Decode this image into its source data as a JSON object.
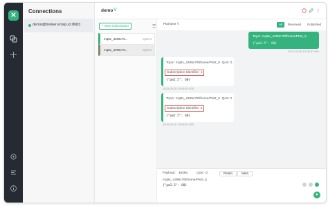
{
  "sidebar": {
    "logo_glyph": "✕",
    "icons": [
      "connections-icon",
      "add-icon",
      "settings-icon",
      "log-icon",
      "about-icon"
    ]
  },
  "connections": {
    "title": "Connections",
    "items": [
      {
        "label": "demo@broker.emqx.io:8083",
        "status": "connected"
      }
    ]
  },
  "header": {
    "title": "demo",
    "chevron": "ᐯ"
  },
  "subscriptions": {
    "new_button": "+ New Subscription",
    "items": [
      {
        "topic": "mqttx_4299c76...",
        "qos": "QoS 0",
        "color": "#35b37e"
      },
      {
        "topic": "mqttx_4299c76...",
        "qos": "QoS 0",
        "color": "#7a8b6b"
      }
    ]
  },
  "messages": {
    "filter_format": "Plaintext",
    "filters": [
      "All",
      "Received",
      "Published"
    ],
    "selected_filter": "All",
    "sent": {
      "topic": "Topic: mqttx_4299c76f/home/PM2_5",
      "payload": "{\"pm2.5\": 60}",
      "time": "2023-05-05 10:08:57:669"
    },
    "received": [
      {
        "topic": "Topic: mqttx_4299c76f/home/PM2_5",
        "qos": "QoS: 0",
        "sub_id": "Subscription Identifier: 1",
        "payload": "{\"pm2.5\": 60}",
        "time": "2023-05-05 10:08:57:676"
      },
      {
        "topic": "Topic: mqttx_4299c76f/home/PM2_5",
        "qos": "QoS: 0",
        "sub_id": "Subscription Identifier: 2",
        "payload": "{\"pm2.5\": 60}",
        "time": "2023-05-05 10:08:57:683"
      }
    ]
  },
  "publish": {
    "payload_label": "Payload:",
    "payload_format": "JSON",
    "qos_label": "QoS:",
    "qos_value": "0",
    "retain_label": "Retain",
    "meta_label": "Meta",
    "topic": "mqttx_4299c76f/home/PM2_5",
    "payload": "{\"pm2.5\": 60}"
  },
  "colors": {
    "accent": "#35b37e",
    "sidebar_bg": "#262b33",
    "highlight_border": "#e0574e"
  }
}
